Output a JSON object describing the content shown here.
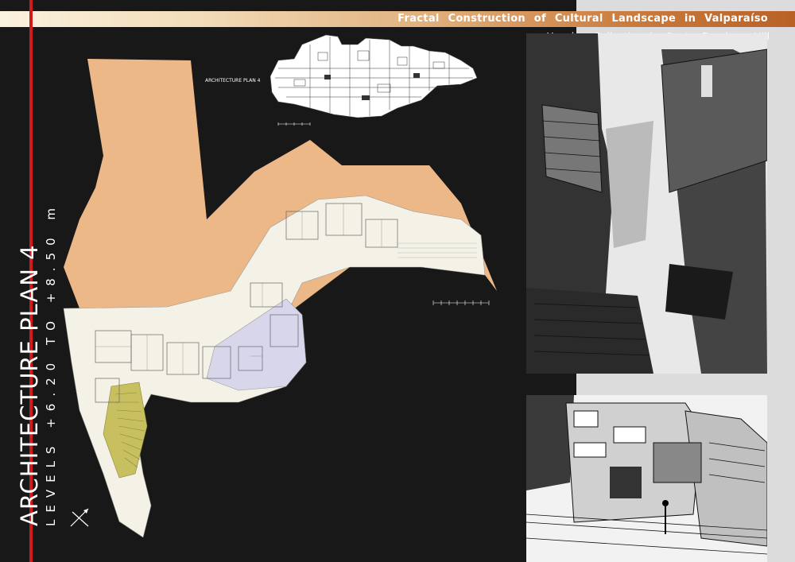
{
  "header": {
    "title": "Fractal Construction of Cultural Landscape in Valparaíso",
    "subtitle": "Housing Collective in Santo Domingo Hill"
  },
  "sheet": {
    "title": "ARCHITECTURE PLAN 4",
    "levels": "LEVELS +6.20 TO +8.50 m"
  },
  "elevation": {
    "label": "ARCHITECTURE PLAN 4"
  },
  "colors": {
    "background": "#181818",
    "accent_red": "#d21a1a",
    "terrain_tan": "#ecb888",
    "plan_cream": "#f4f2e6",
    "plaza_lavender": "#d8d6ea",
    "stair_yellow": "#c8c060"
  },
  "icons": {
    "compass": "north-arrow-icon"
  }
}
